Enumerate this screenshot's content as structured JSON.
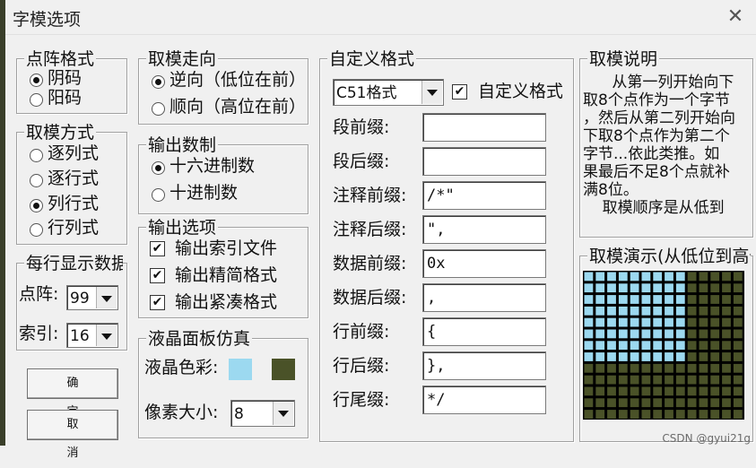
{
  "window": {
    "title": "字模选项",
    "close_symbol": "✕"
  },
  "dot_format": {
    "legend": "点阵格式",
    "options": [
      "阴码",
      "阳码"
    ],
    "selected": 0
  },
  "take_mode": {
    "legend": "取模方式",
    "options": [
      "逐列式",
      "逐行式",
      "列行式",
      "行列式"
    ],
    "selected": 2
  },
  "per_line": {
    "legend": "每行显示数据",
    "dot_label": "点阵:",
    "dot_value": "99",
    "index_label": "索引:",
    "index_value": "16"
  },
  "buttons": {
    "ok": "确 定",
    "cancel": "取 消"
  },
  "direction": {
    "legend": "取模走向",
    "options": [
      "逆向（低位在前）",
      "顺向（高位在前）"
    ],
    "selected": 0
  },
  "output_base": {
    "legend": "输出数制",
    "options": [
      "十六进制数",
      "十进制数"
    ],
    "selected": 0
  },
  "output_options": {
    "legend": "输出选项",
    "items": [
      {
        "label": "输出索引文件",
        "checked": true
      },
      {
        "label": "输出精简格式",
        "checked": true
      },
      {
        "label": "输出紧凑格式",
        "checked": true
      }
    ]
  },
  "lcd_sim": {
    "legend": "液晶面板仿真",
    "color_label": "液晶色彩:",
    "color_on": "#9cd9f0",
    "color_off": "#4a5228",
    "size_label": "像素大小:",
    "size_value": "8"
  },
  "custom_format": {
    "legend": "自定义格式",
    "format_value": "C51格式",
    "custom_checkbox_label": "自定义格式",
    "custom_checked": true,
    "fields": [
      {
        "label": "段前缀:",
        "value": ""
      },
      {
        "label": "段后缀:",
        "value": ""
      },
      {
        "label": "注释前缀:",
        "value": "/*\""
      },
      {
        "label": "注释后缀:",
        "value": "\","
      },
      {
        "label": "数据前缀:",
        "value": "0x"
      },
      {
        "label": "数据后缀:",
        "value": ","
      },
      {
        "label": "行前缀:",
        "value": "{"
      },
      {
        "label": "行后缀:",
        "value": "},"
      },
      {
        "label": "行尾缀:",
        "value": "*/"
      }
    ]
  },
  "description": {
    "legend": "取模说明",
    "lines": [
      "      从第一列开始向下",
      "取8个点作为一个字节",
      "，然后从第二列开始向",
      "下取8个点作为第二个",
      "字节...依此类推。如",
      "果最后不足8个点就补",
      "满8位。",
      "    取模顺序是从低到"
    ]
  },
  "demo": {
    "legend": "取模演示(从低位到高位)",
    "cols": 14,
    "rows": 13,
    "lit": [
      [
        0,
        8
      ],
      [
        1,
        8
      ],
      [
        2,
        8
      ],
      [
        3,
        8
      ],
      [
        4,
        8
      ],
      [
        5,
        8
      ],
      [
        6,
        8
      ],
      [
        7,
        8
      ],
      [
        8,
        8
      ],
      [
        9,
        8
      ],
      [
        10,
        8
      ],
      [
        0,
        8
      ],
      [
        1,
        8
      ],
      [
        2,
        8
      ]
    ]
  },
  "watermark": "CSDN @gyui21g"
}
